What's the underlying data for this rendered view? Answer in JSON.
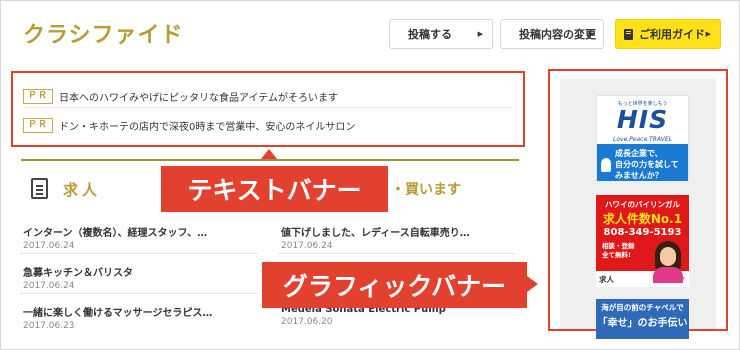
{
  "header": {
    "logo": "クラシファイド",
    "buttons": {
      "post": "投稿する",
      "edit": "投稿内容の変更",
      "guide": "ご利用ガイド"
    }
  },
  "text_banner": {
    "pr_tag": "ＰＲ",
    "rows": [
      "日本へのハワイみやげにピッタリな食品アイテムがそろいます",
      "ドン・キホーテの店内で深夜0時まで営業中、安心のネイルサロン"
    ]
  },
  "sections": {
    "left_title": "求人",
    "right_title_fragment": "・買います"
  },
  "annotations": {
    "text_banner": "テキストバナー",
    "graphic_banner": "グラフィックバナー"
  },
  "listings": {
    "left": [
      {
        "title": "インターン（複数名）、経理スタッフ、…",
        "date": "2017.06.24"
      },
      {
        "title": "急募キッチン＆バリスタ",
        "date": "2017.06.24"
      },
      {
        "title": "一緒に楽しく働けるマッサージセラピス…",
        "date": "2017.06.23"
      }
    ],
    "right": [
      {
        "title": "値下げしました、レディース自転車売り…",
        "date": "2017.06.24"
      },
      {
        "title": "Medela Sonata Electric Pump",
        "date": "2017.06.20"
      }
    ]
  },
  "ads": {
    "his": {
      "top_text": "もっと世界を楽しもう",
      "logo": "HIS",
      "slogan": "Love.Peace.TRAVEL",
      "line1": "成長企業で、",
      "line2": "自分の力を試して",
      "line3": "みませんか？"
    },
    "job": {
      "top": "ハワイのバイリンガル",
      "count": "求人件数No.1",
      "tel": "808-349-5193",
      "note1": "相談・登録",
      "note2": "全て無料!",
      "kyujin": "求人",
      "name": "ジュン"
    },
    "wedding": {
      "line1": "海が目の前のチャペルで",
      "line2": "「幸せ」のお手伝い"
    }
  },
  "colors": {
    "accent_gold": "#b79d35",
    "annotation_red": "#e2412f",
    "guide_yellow": "#ffe11a"
  }
}
